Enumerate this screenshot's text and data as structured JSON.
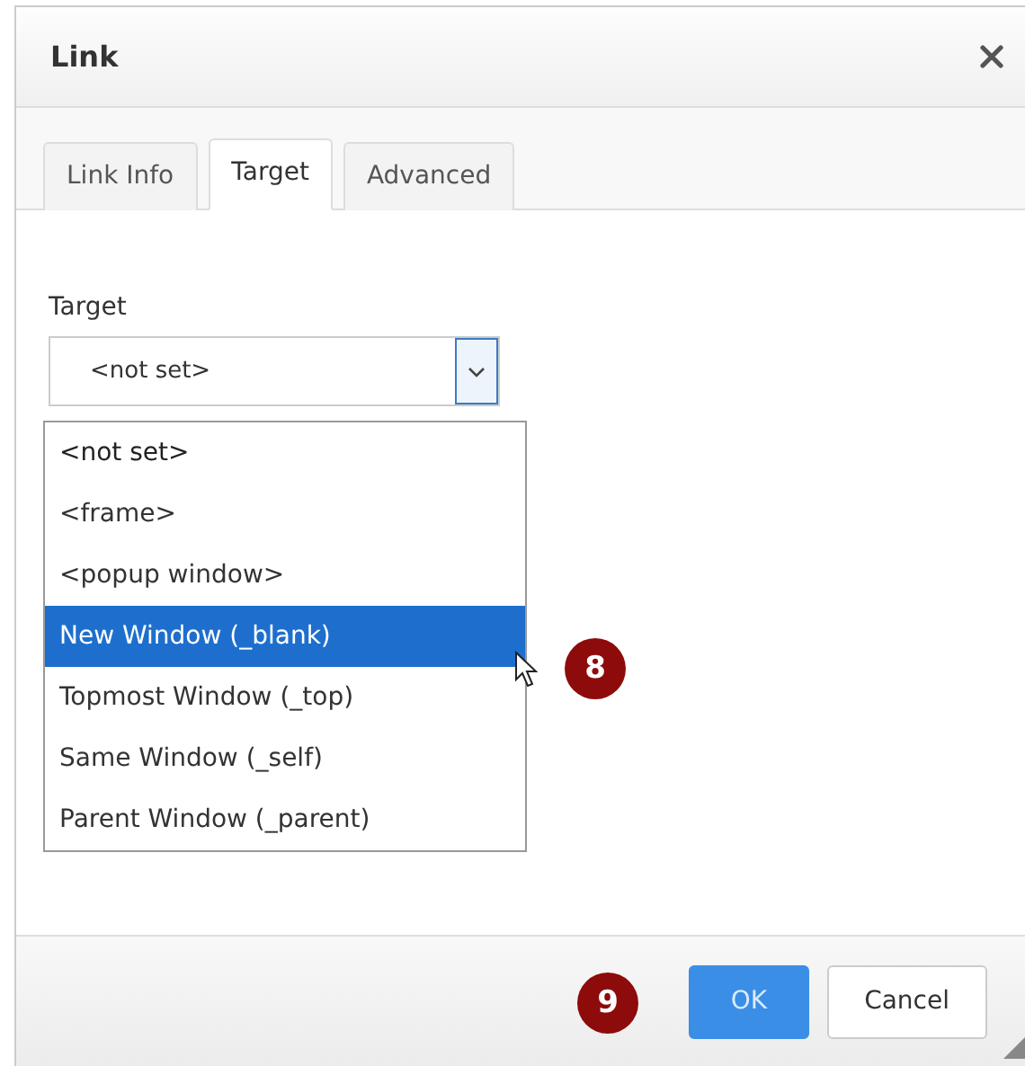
{
  "dialog": {
    "title": "Link"
  },
  "tabs": [
    {
      "label": "Link Info",
      "selected": false
    },
    {
      "label": "Target",
      "selected": true
    },
    {
      "label": "Advanced",
      "selected": false
    }
  ],
  "field": {
    "label": "Target",
    "value": "<not set>",
    "expanded": true,
    "callout": "8",
    "options": [
      {
        "label": "<not set>",
        "selected": true,
        "highlighted": false
      },
      {
        "label": "<frame>",
        "selected": false,
        "highlighted": false
      },
      {
        "label": "<popup window>",
        "selected": false,
        "highlighted": false
      },
      {
        "label": "New Window (_blank)",
        "selected": false,
        "highlighted": true
      },
      {
        "label": "Topmost Window (_top)",
        "selected": false,
        "highlighted": false
      },
      {
        "label": "Same Window (_self)",
        "selected": false,
        "highlighted": false
      },
      {
        "label": "Parent Window (_parent)",
        "selected": false,
        "highlighted": false
      }
    ]
  },
  "buttons": [
    {
      "label": "OK",
      "kind": "primary"
    },
    {
      "label": "Cancel",
      "kind": "default"
    }
  ],
  "footer": {
    "callout": "9"
  }
}
